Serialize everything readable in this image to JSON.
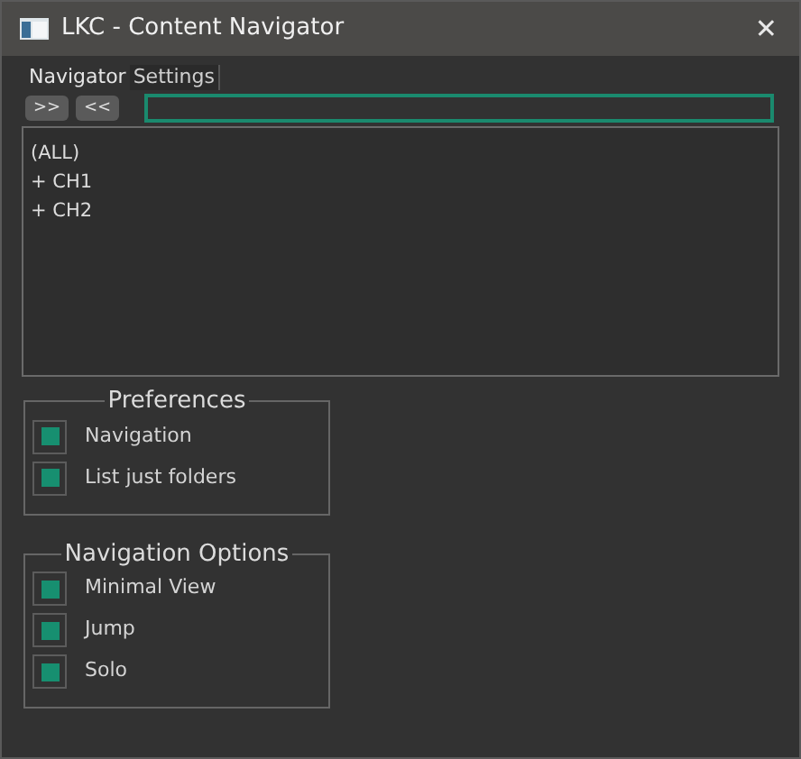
{
  "window": {
    "title": "LKC - Content Navigator",
    "close": "✕"
  },
  "tabs": [
    {
      "label": "Navigator",
      "selected": true
    },
    {
      "label": "Settings",
      "selected": false
    }
  ],
  "toolbar": {
    "buttons": [
      ">>",
      "<<"
    ]
  },
  "tree": {
    "items": [
      "(ALL)",
      "+ CH1",
      "+ CH2"
    ]
  },
  "groups": [
    {
      "title": "Preferences",
      "options": [
        {
          "label": "Navigation",
          "checked": true
        },
        {
          "label": "List just folders",
          "checked": true
        }
      ]
    },
    {
      "title": "Navigation Options",
      "options": [
        {
          "label": "Minimal View",
          "checked": true
        },
        {
          "label": "Jump",
          "checked": true
        },
        {
          "label": "Solo",
          "checked": true
        }
      ]
    }
  ]
}
